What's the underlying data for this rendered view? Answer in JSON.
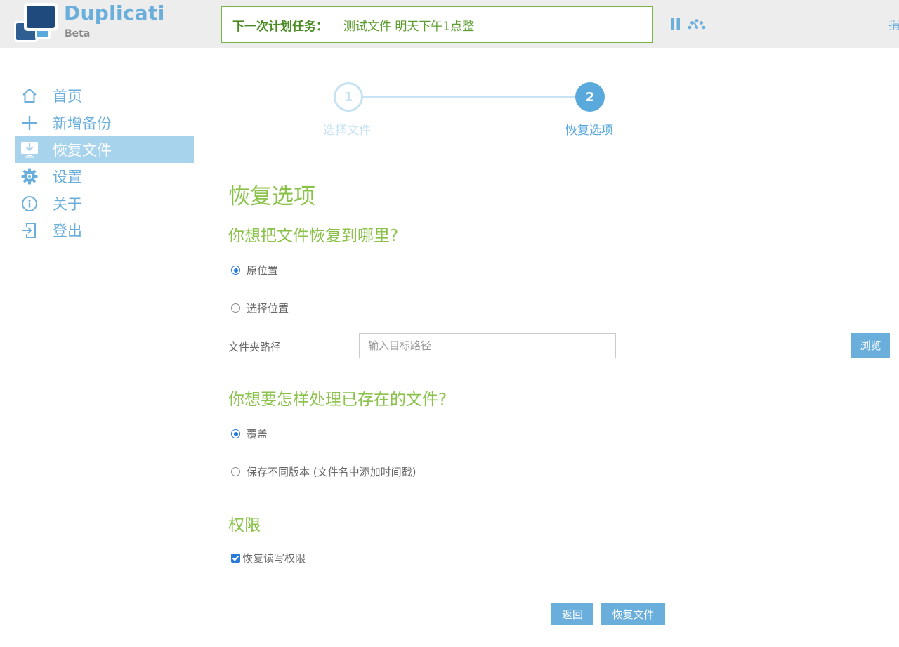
{
  "header": {
    "brand": "Duplicati",
    "brand_sub": "Beta",
    "schedule_label": "下一次计划任务：",
    "schedule_value": "测试文件 明天下午1点整",
    "donate": "捐"
  },
  "sidebar": {
    "items": [
      {
        "label": "首页",
        "icon": "home-icon"
      },
      {
        "label": "新增备份",
        "icon": "plus-icon"
      },
      {
        "label": "恢复文件",
        "icon": "restore-icon",
        "active": true
      },
      {
        "label": "设置",
        "icon": "gear-icon"
      },
      {
        "label": "关于",
        "icon": "info-icon"
      },
      {
        "label": "登出",
        "icon": "logout-icon"
      }
    ]
  },
  "stepper": {
    "steps": [
      {
        "number": "1",
        "label": "选择文件"
      },
      {
        "number": "2",
        "label": "恢复选项"
      }
    ],
    "current": 2
  },
  "main": {
    "title": "恢复选项",
    "where_heading": "你想把文件恢复到哪里?",
    "where_options": [
      {
        "label": "原位置",
        "checked": true
      },
      {
        "label": "选择位置",
        "checked": false
      }
    ],
    "folder_label": "文件夹路径",
    "folder_placeholder": "输入目标路径",
    "folder_value": "",
    "browse_label": "浏览",
    "existing_heading": "你想要怎样处理已存在的文件?",
    "existing_options": [
      {
        "label": "覆盖",
        "checked": true
      },
      {
        "label": "保存不同版本 (文件名中添加时间戳)",
        "checked": false
      }
    ],
    "permissions_heading": "权限",
    "permissions_checkbox": {
      "label": "恢复读写权限",
      "checked": true
    },
    "back_label": "返回",
    "restore_label": "恢复文件"
  },
  "colors": {
    "accent_blue": "#6aaedc",
    "accent_green": "#8ac24a",
    "active_nav_bg": "#a8d3ec",
    "radio_blue": "#2a7ad8"
  }
}
